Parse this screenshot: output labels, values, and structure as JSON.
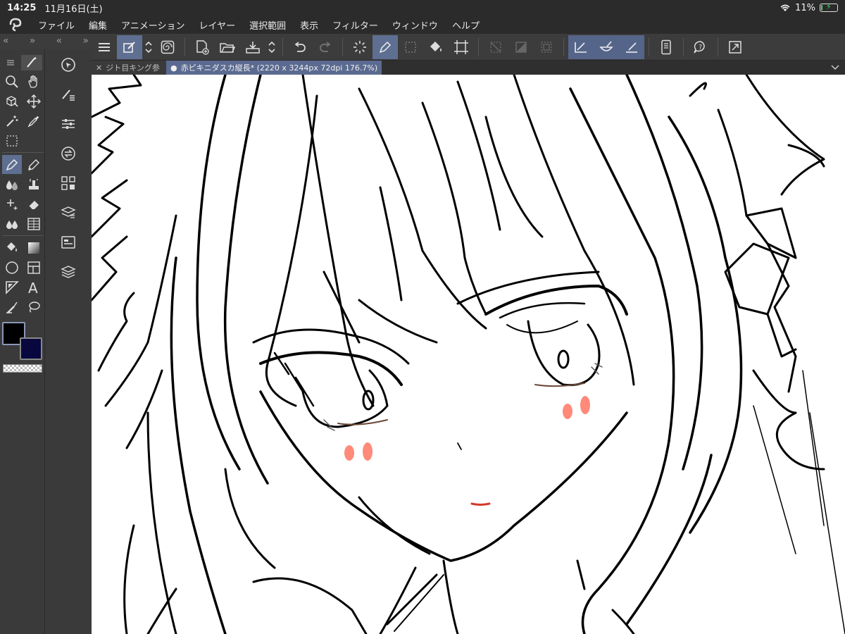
{
  "status": {
    "time": "14:25",
    "date": "11月16日(土)",
    "battery": "11%",
    "battery_level": 0.11
  },
  "menu": [
    "ファイル",
    "編集",
    "アニメーション",
    "レイヤー",
    "選択範囲",
    "表示",
    "フィルター",
    "ウィンドウ",
    "ヘルプ"
  ],
  "tabs": {
    "inactive": "ジト目キング参",
    "active": "赤ピキニダスカ縦長* (2220 x 3244px 72dpi 176.7%)"
  },
  "colors": {
    "accent": "#5f6f92",
    "main_color": "#000000",
    "sub_color": "#08083f",
    "blush": "#ff8a7a",
    "mouth": "#d23b2a"
  },
  "icons": {
    "command_bar": [
      "hamburger-icon",
      "pen-edit-icon",
      "updown-icon",
      "spiral-icon",
      "new-file-icon",
      "open-folder-icon",
      "save-icon",
      "updown-icon",
      "undo-icon",
      "redo-icon",
      "loading-icon",
      "pen-icon",
      "selection-dots-icon",
      "fill-icon",
      "transform-icon",
      "deselect-icon",
      "invert-icon",
      "border-icon",
      "ruler-pen-icon",
      "brush-bowl-icon",
      "ruler-icon",
      "phone-icon",
      "help-icon",
      "expand-icon"
    ],
    "tools": [
      "magnifier-icon",
      "hand-icon",
      "cube-cursor-icon",
      "move-icon",
      "magic-wand-icon",
      "eyedropper-icon",
      "marquee-icon",
      "pen-tool-icon",
      "pencil-icon",
      "droplets-icon",
      "stamp-icon",
      "sparkle-icon",
      "eraser-icon",
      "blend-icon",
      "grid-icon",
      "bucket-icon",
      "gradient-icon",
      "circle-icon",
      "frame-icon",
      "triangle-ruler-icon",
      "text-icon",
      "paint-icon",
      "lasso-icon"
    ],
    "palettes": [
      "navigator-icon",
      "brush-settings-icon",
      "sliders-icon",
      "convert-icon",
      "nodes-icon",
      "layer-props-icon",
      "card-icon",
      "layers-icon"
    ]
  }
}
